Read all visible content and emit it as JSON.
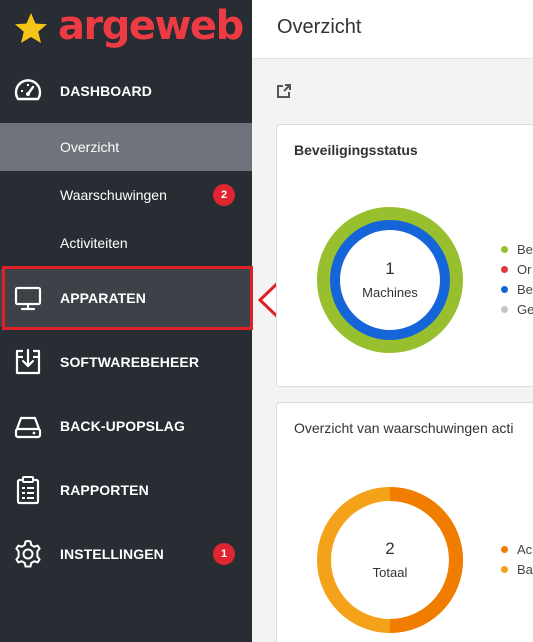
{
  "brand": {
    "name": "argeweb"
  },
  "colors": {
    "brand_red": "#ee3b43",
    "star_yellow": "#f5c518",
    "sidebar_bg": "#282c33",
    "badge_red": "#e02531",
    "highlight_red": "#e01f26",
    "green": "#97bf2e",
    "blue": "#1565d8",
    "orange_dark": "#f07d00",
    "orange_light": "#f5a21b"
  },
  "sidebar": {
    "dashboard": {
      "label": "DASHBOARD",
      "icon": "speedometer-icon"
    },
    "sub_items": [
      {
        "label": "Overzicht",
        "active": true
      },
      {
        "label": "Waarschuwingen",
        "badge": "2"
      },
      {
        "label": "Activiteiten"
      }
    ],
    "items": [
      {
        "label": "APPARATEN",
        "icon": "monitor-icon",
        "highlighted": true
      },
      {
        "label": "SOFTWAREBEHEER",
        "icon": "software-download-icon"
      },
      {
        "label": "BACK-UPOPSLAG",
        "icon": "drive-icon"
      },
      {
        "label": "RAPPORTEN",
        "icon": "clipboard-icon"
      },
      {
        "label": "INSTELLINGEN",
        "icon": "gear-icon",
        "badge": "1"
      }
    ]
  },
  "header": {
    "title": "Overzicht"
  },
  "widgets": [
    {
      "title": "Beveiligingsstatus",
      "center_value": "1",
      "center_label": "Machines",
      "legend": [
        "Be",
        "Or",
        "Be",
        "Ge"
      ]
    },
    {
      "title": "Overzicht van waarschuwingen acti",
      "center_value": "2",
      "center_label": "Totaal",
      "legend": [
        "Ac",
        "Ba"
      ]
    }
  ]
}
